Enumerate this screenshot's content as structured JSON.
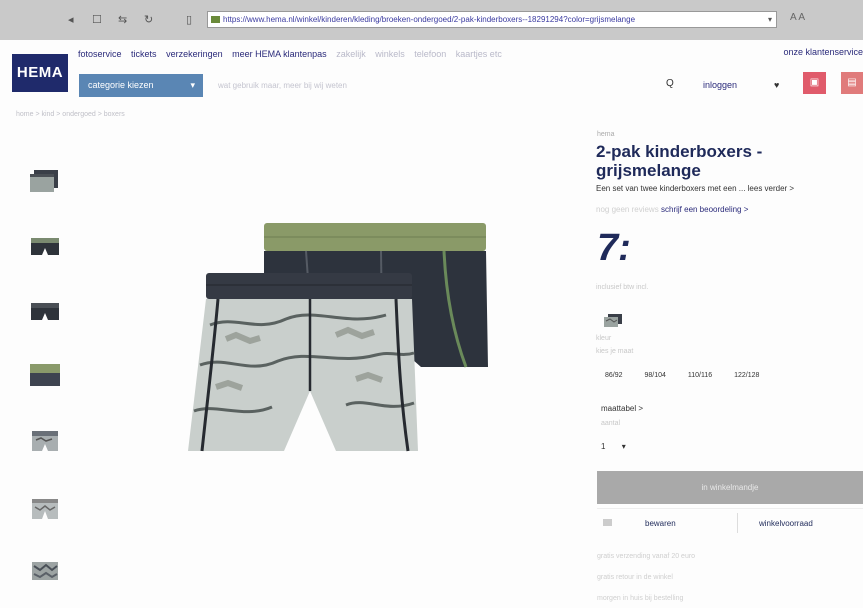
{
  "browser": {
    "url": "https://www.hema.nl/winkel/kinderen/kleding/broeken-ondergoed/2-pak-kinderboxers--18291294?color=grijsmelange",
    "right": "A  A"
  },
  "header": {
    "logo": "HEMA",
    "nav": [
      "fotoservice",
      "tickets",
      "verzekeringen",
      "meer HEMA klantenpas"
    ],
    "nav_faded": [
      "zakelijk",
      "winkels",
      "telefoon",
      "kaartjes etc"
    ],
    "nav_right": "onze klantenservice",
    "category_button": "categorie kiezen",
    "search_placeholder": "wat gebruik maar, meer bij wij weten",
    "login": "inloggen"
  },
  "breadcrumb": "home > kind > ondergoed > boxers",
  "product": {
    "brand": "hema",
    "title": "2-pak kinderboxers - grijsmelange",
    "description": "Een set van twee kinderboxers met een ... lees verder >",
    "review_faded": "nog geen reviews",
    "review_link": "schrijf een beoordeling >",
    "price": "7:",
    "price_note": "inclusief btw incl.",
    "color_label": "kleur",
    "size_label": "kies je maat",
    "sizes": [
      "86/92",
      "98/104",
      "110/116",
      "122/128"
    ],
    "size_chart": "maattabel >",
    "quantity_label": "aantal",
    "quantity": "1",
    "add_to_cart": "in winkelmandje",
    "save": "bewaren",
    "store_stock": "winkelvoorraad",
    "usps": [
      "gratis verzending vanaf 20 euro",
      "gratis retour in de winkel",
      "morgen in huis bij bestelling"
    ]
  },
  "colors": {
    "logo_bg": "#1f2a6b",
    "category_bg": "#5a86b4",
    "cart_bg": "#e05b6b",
    "title": "#1f2a5a"
  }
}
